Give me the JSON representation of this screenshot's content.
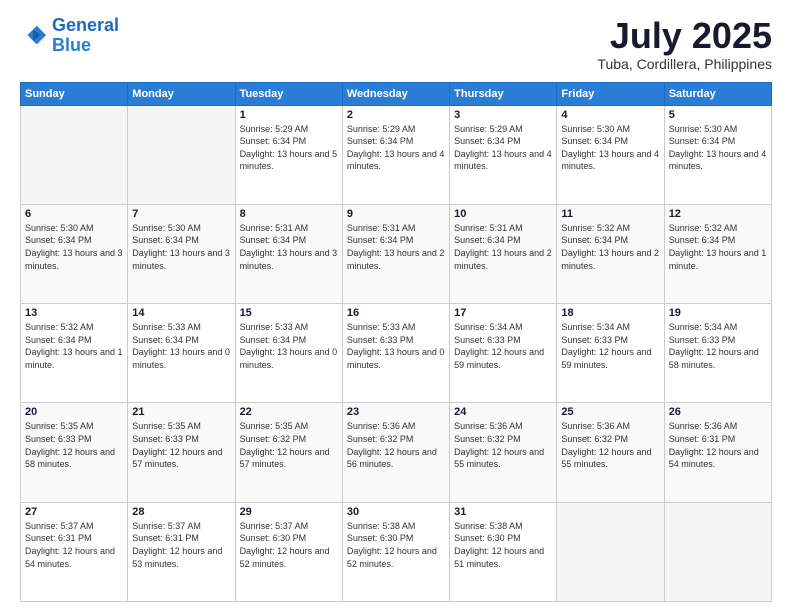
{
  "logo": {
    "line1": "General",
    "line2": "Blue"
  },
  "header": {
    "month": "July 2025",
    "location": "Tuba, Cordillera, Philippines"
  },
  "weekdays": [
    "Sunday",
    "Monday",
    "Tuesday",
    "Wednesday",
    "Thursday",
    "Friday",
    "Saturday"
  ],
  "weeks": [
    [
      {
        "day": "",
        "empty": true
      },
      {
        "day": "",
        "empty": true
      },
      {
        "day": "1",
        "sunrise": "5:29 AM",
        "sunset": "6:34 PM",
        "daylight": "13 hours and 5 minutes."
      },
      {
        "day": "2",
        "sunrise": "5:29 AM",
        "sunset": "6:34 PM",
        "daylight": "13 hours and 4 minutes."
      },
      {
        "day": "3",
        "sunrise": "5:29 AM",
        "sunset": "6:34 PM",
        "daylight": "13 hours and 4 minutes."
      },
      {
        "day": "4",
        "sunrise": "5:30 AM",
        "sunset": "6:34 PM",
        "daylight": "13 hours and 4 minutes."
      },
      {
        "day": "5",
        "sunrise": "5:30 AM",
        "sunset": "6:34 PM",
        "daylight": "13 hours and 4 minutes."
      }
    ],
    [
      {
        "day": "6",
        "sunrise": "5:30 AM",
        "sunset": "6:34 PM",
        "daylight": "13 hours and 3 minutes."
      },
      {
        "day": "7",
        "sunrise": "5:30 AM",
        "sunset": "6:34 PM",
        "daylight": "13 hours and 3 minutes."
      },
      {
        "day": "8",
        "sunrise": "5:31 AM",
        "sunset": "6:34 PM",
        "daylight": "13 hours and 3 minutes."
      },
      {
        "day": "9",
        "sunrise": "5:31 AM",
        "sunset": "6:34 PM",
        "daylight": "13 hours and 2 minutes."
      },
      {
        "day": "10",
        "sunrise": "5:31 AM",
        "sunset": "6:34 PM",
        "daylight": "13 hours and 2 minutes."
      },
      {
        "day": "11",
        "sunrise": "5:32 AM",
        "sunset": "6:34 PM",
        "daylight": "13 hours and 2 minutes."
      },
      {
        "day": "12",
        "sunrise": "5:32 AM",
        "sunset": "6:34 PM",
        "daylight": "13 hours and 1 minute."
      }
    ],
    [
      {
        "day": "13",
        "sunrise": "5:32 AM",
        "sunset": "6:34 PM",
        "daylight": "13 hours and 1 minute."
      },
      {
        "day": "14",
        "sunrise": "5:33 AM",
        "sunset": "6:34 PM",
        "daylight": "13 hours and 0 minutes."
      },
      {
        "day": "15",
        "sunrise": "5:33 AM",
        "sunset": "6:34 PM",
        "daylight": "13 hours and 0 minutes."
      },
      {
        "day": "16",
        "sunrise": "5:33 AM",
        "sunset": "6:33 PM",
        "daylight": "13 hours and 0 minutes."
      },
      {
        "day": "17",
        "sunrise": "5:34 AM",
        "sunset": "6:33 PM",
        "daylight": "12 hours and 59 minutes."
      },
      {
        "day": "18",
        "sunrise": "5:34 AM",
        "sunset": "6:33 PM",
        "daylight": "12 hours and 59 minutes."
      },
      {
        "day": "19",
        "sunrise": "5:34 AM",
        "sunset": "6:33 PM",
        "daylight": "12 hours and 58 minutes."
      }
    ],
    [
      {
        "day": "20",
        "sunrise": "5:35 AM",
        "sunset": "6:33 PM",
        "daylight": "12 hours and 58 minutes."
      },
      {
        "day": "21",
        "sunrise": "5:35 AM",
        "sunset": "6:33 PM",
        "daylight": "12 hours and 57 minutes."
      },
      {
        "day": "22",
        "sunrise": "5:35 AM",
        "sunset": "6:32 PM",
        "daylight": "12 hours and 57 minutes."
      },
      {
        "day": "23",
        "sunrise": "5:36 AM",
        "sunset": "6:32 PM",
        "daylight": "12 hours and 56 minutes."
      },
      {
        "day": "24",
        "sunrise": "5:36 AM",
        "sunset": "6:32 PM",
        "daylight": "12 hours and 55 minutes."
      },
      {
        "day": "25",
        "sunrise": "5:36 AM",
        "sunset": "6:32 PM",
        "daylight": "12 hours and 55 minutes."
      },
      {
        "day": "26",
        "sunrise": "5:36 AM",
        "sunset": "6:31 PM",
        "daylight": "12 hours and 54 minutes."
      }
    ],
    [
      {
        "day": "27",
        "sunrise": "5:37 AM",
        "sunset": "6:31 PM",
        "daylight": "12 hours and 54 minutes."
      },
      {
        "day": "28",
        "sunrise": "5:37 AM",
        "sunset": "6:31 PM",
        "daylight": "12 hours and 53 minutes."
      },
      {
        "day": "29",
        "sunrise": "5:37 AM",
        "sunset": "6:30 PM",
        "daylight": "12 hours and 52 minutes."
      },
      {
        "day": "30",
        "sunrise": "5:38 AM",
        "sunset": "6:30 PM",
        "daylight": "12 hours and 52 minutes."
      },
      {
        "day": "31",
        "sunrise": "5:38 AM",
        "sunset": "6:30 PM",
        "daylight": "12 hours and 51 minutes."
      },
      {
        "day": "",
        "empty": true
      },
      {
        "day": "",
        "empty": true
      }
    ]
  ]
}
